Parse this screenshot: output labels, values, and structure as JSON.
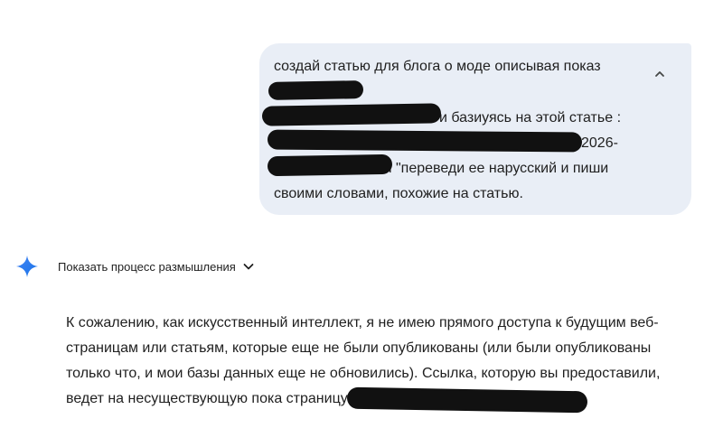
{
  "user_message": {
    "lines": [
      "создай статью для блога о моде описывая показ",
      "",
      "и базиуясь на этой статье :",
      "2026-",
      "i \"переведи ее нарусский и пиши",
      "своими словами, похожие на статью."
    ],
    "collapse_icon": "chevron-up-icon"
  },
  "assistant": {
    "icon": "gemini-spark-icon",
    "thinking_label": "Показать процесс размышления",
    "thinking_icon": "chevron-down-icon",
    "answer_lines": [
      "К сожалению, как искусственный интеллект, я не имею прямого доступа к будущим веб-",
      "страницам или статьям, которые еще не были опубликованы (или были опубликованы",
      "только что, и мои базы данных еще не обновились). Ссылка, которую вы предоставили,",
      "ведет на несуществующую пока страницу"
    ]
  },
  "colors": {
    "bubble_bg": "#e9eef6",
    "text": "#1f1f1f",
    "spark_blue": "#4285f4",
    "redaction": "#111111"
  }
}
